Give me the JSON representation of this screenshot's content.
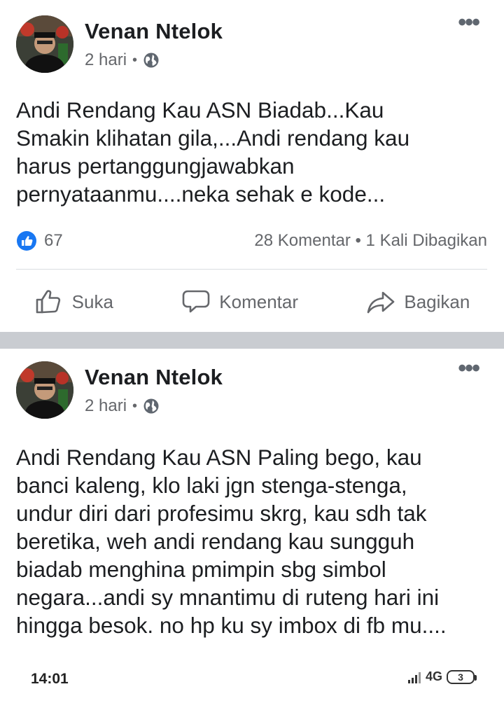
{
  "posts": [
    {
      "author": "Venan Ntelok",
      "time": "2 hari",
      "dot": "•",
      "body": "Andi Rendang Kau ASN Biadab...Kau\nSmakin klihatan gila,...Andi rendang kau\nharus pertanggungjawabkan\npernyataanmu....neka sehak  e kode...",
      "likes": "67",
      "comments_shares": "28 Komentar • 1 Kali Dibagikan",
      "actions": {
        "like": "Suka",
        "comment": "Komentar",
        "share": "Bagikan"
      }
    },
    {
      "author": "Venan Ntelok",
      "time": "2 hari",
      "dot": "•",
      "body": "Andi Rendang Kau ASN Paling bego, kau\nbanci kaleng, klo laki jgn stenga-stenga,\nundur diri dari profesimu skrg, kau sdh tak\nberetika, weh andi rendang kau sungguh\nbiadab menghina pmimpin sbg simbol\nnegara...andi sy mnantimu di ruteng hari ini\nhingga besok. no hp ku sy imbox di fb mu...."
    }
  ],
  "status_bar": {
    "time": "14:01",
    "network": "4G",
    "battery": "3"
  },
  "colors": {
    "like_blue": "#1877f2",
    "secondary_text": "#65676b",
    "divider": "#c9ccd1"
  }
}
